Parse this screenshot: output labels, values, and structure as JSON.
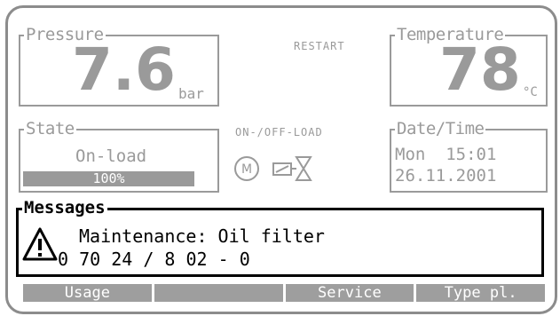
{
  "pressure": {
    "title": "Pressure",
    "value": "7.6",
    "unit": "bar"
  },
  "status_restart": "RESTART",
  "temperature": {
    "title": "Temperature",
    "value": "78",
    "unit": "°C"
  },
  "state": {
    "title": "State",
    "value": "On-load",
    "load_percent_text": "100%",
    "load_fraction": 1.0
  },
  "mode_label": "ON-/OFF-LOAD",
  "datetime": {
    "title": "Date/Time",
    "day_time": "Mon  15:01",
    "date": "26.11.2001"
  },
  "messages": {
    "title": "Messages",
    "line1": "Maintenance: Oil filter",
    "line2": "0 70 24 / 8 02 - 0"
  },
  "softkeys": [
    "Usage",
    "",
    "Service",
    "Type pl."
  ],
  "colors": {
    "frame": "#8c8c8c",
    "inactive": "#9a9a9a",
    "active": "#000000"
  },
  "icons": [
    "motor-icon",
    "load-valve-icon",
    "warning-icon"
  ]
}
